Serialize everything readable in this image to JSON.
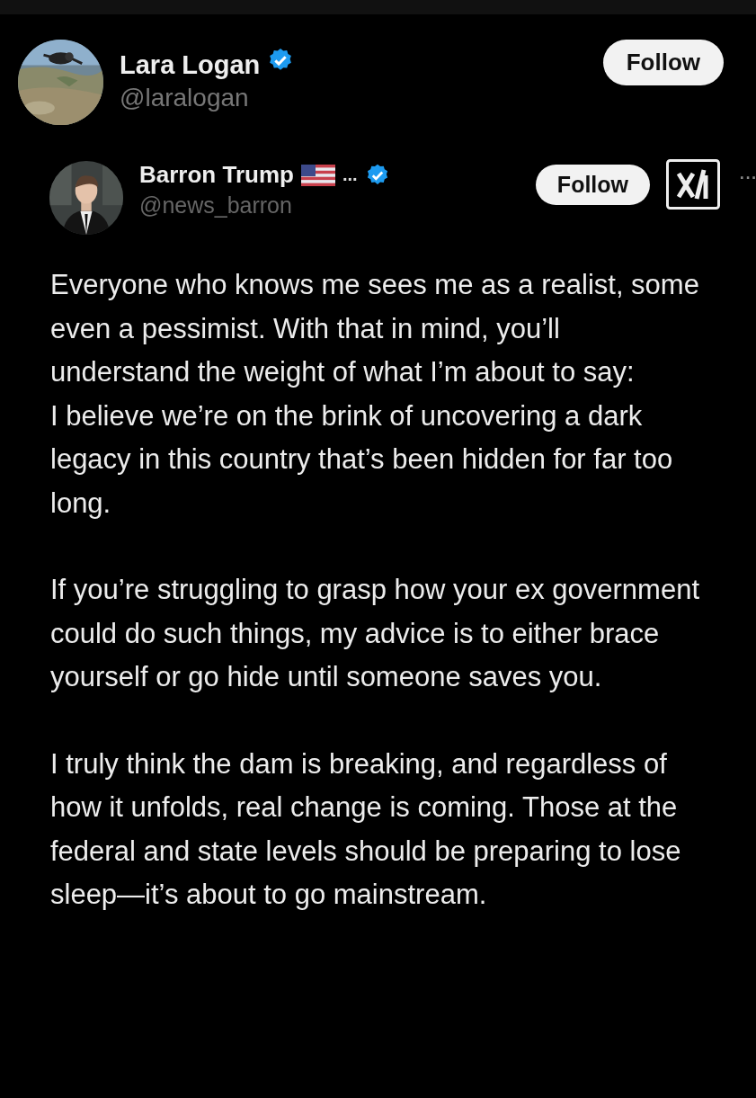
{
  "post": {
    "author": {
      "name": "Lara Logan",
      "verified": true,
      "handle": "@laralogan"
    },
    "follow_button": "Follow"
  },
  "embedded_post": {
    "author": {
      "name": "Barron Trump",
      "name_suffix": "...",
      "verified": true,
      "handle": "@news_barron"
    },
    "follow_button": "Follow",
    "more": "···",
    "paragraphs": [
      [
        "Everyone who knows me sees me as a realist, some even a pessimist. With that in mind, you’ll understand the weight of what I’m about to say:",
        "I believe we’re on the brink of uncovering a dark legacy in this country that’s been hidden for far too long."
      ],
      [
        "If you’re struggling to grasp how your ex government could do such things, my advice is to either brace yourself or go hide until someone saves you."
      ],
      [
        "I truly think the dam is breaking, and regardless of how it unfolds, real change is coming. Those at the federal and state levels should be preparing to lose sleep—it’s about to go mainstream."
      ]
    ]
  }
}
